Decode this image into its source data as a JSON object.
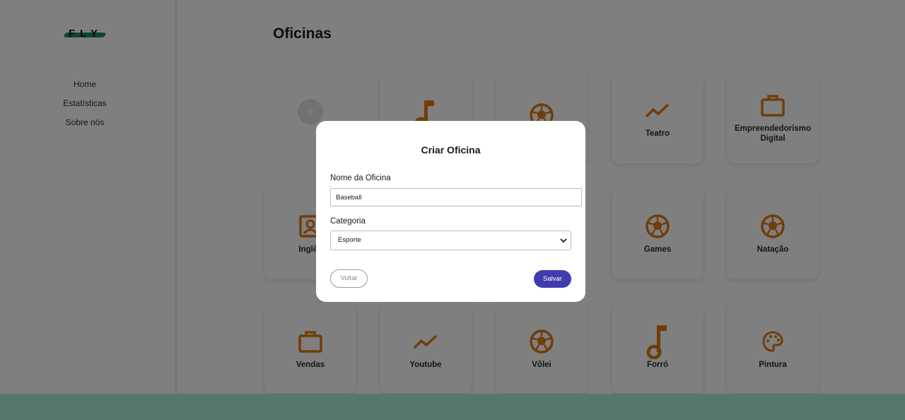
{
  "brand": {
    "logo_text": "FLY",
    "accent": "#1f8a6d"
  },
  "sidebar": {
    "items": [
      {
        "label": "Home"
      },
      {
        "label": "Estatísticas"
      },
      {
        "label": "Sobre nós"
      }
    ]
  },
  "page": {
    "title": "Oficinas",
    "add_symbol": "+"
  },
  "icon_color": "#e07b12",
  "cards": [
    {
      "label": "",
      "icon": "music-note-icon"
    },
    {
      "label": "",
      "icon": "soccer-ball-icon"
    },
    {
      "label": "Teatro",
      "icon": "trending-line-icon"
    },
    {
      "label": "Empreendedorismo Digital",
      "icon": "briefcase-icon"
    },
    {
      "label": "Inglês",
      "icon": "portrait-icon"
    },
    {
      "label": "Games",
      "icon": "soccer-ball-icon"
    },
    {
      "label": "Natação",
      "icon": "soccer-ball-icon"
    },
    {
      "label": "Vendas",
      "icon": "briefcase-icon"
    },
    {
      "label": "Youtube",
      "icon": "trending-line-icon"
    },
    {
      "label": "Vôlei",
      "icon": "soccer-ball-icon"
    },
    {
      "label": "Forró",
      "icon": "music-note-icon"
    },
    {
      "label": "Pintura",
      "icon": "palette-icon"
    }
  ],
  "modal": {
    "title": "Criar Oficina",
    "name_label": "Nome da Oficina",
    "name_value": "Baseball",
    "category_label": "Categoria",
    "category_value": "Esporte",
    "back_label": "Voltar",
    "save_label": "Salvar",
    "save_color": "#3f3dae"
  },
  "footer_color": "#a8f0d5"
}
